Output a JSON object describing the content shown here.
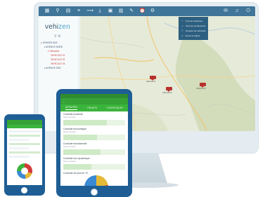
{
  "brand": {
    "logo_left": "vehi",
    "logo_right": "zen",
    "primary": "#3f7598",
    "green": "#35a235",
    "device_blue": "#1e5e95"
  },
  "toolbar": {
    "icons": [
      "grid-icon",
      "search-icon",
      "doc-icon",
      "list-icon",
      "route-icon",
      "download-icon",
      "calendar-icon",
      "report-icon",
      "wrench-icon",
      "alarm-icon",
      "gear-icon"
    ],
    "right_icons": [
      "mail-icon",
      "bell-icon",
      "power-icon"
    ]
  },
  "dropdown": {
    "items": [
      {
        "icon": "car-icon",
        "label": "Tous les véhicules"
      },
      {
        "icon": "user-icon",
        "label": "Tous les conducteurs"
      },
      {
        "icon": "group-icon",
        "label": "Groupes de véhicules"
      },
      {
        "icon": "zone-icon",
        "label": "Zones et trajets"
      }
    ]
  },
  "sidebar": {
    "tree": [
      {
        "label": "▸ VEHIZEN SAS",
        "level": 1
      },
      {
        "label": "▾ AGENCE NORD",
        "level": 2
      },
      {
        "label": "▾ Véhicules",
        "level": 3
      },
      {
        "label": "VEHICULE 01",
        "level": 4
      },
      {
        "label": "VEHICULE 02",
        "level": 4
      },
      {
        "label": "VEHICULE 03",
        "level": 4
      },
      {
        "label": "▸ AGENCE SUD",
        "level": 2
      }
    ]
  },
  "map": {
    "pins": [
      {
        "label": "Véhicule 01"
      },
      {
        "label": "Véhicule 02"
      },
      {
        "label": "Véhicule 03"
      }
    ]
  },
  "tablet": {
    "appbar": "←",
    "tabs": [
      "ACTIVITÉS",
      "TRAJETS",
      "STATISTIQUES"
    ],
    "cards": [
      {
        "title": "Conduite prudente",
        "sub": "Score mensuel",
        "fill": 0.7
      },
      {
        "title": "Conduite économique",
        "sub": "Score mensuel",
        "fill": 0.55
      },
      {
        "title": "Conduite fonctionnelle",
        "sub": "Score mensuel",
        "fill": 0.6
      },
      {
        "title": "Conduite éco-dynamique",
        "sub": "Score mensuel",
        "fill": 0.45
      },
      {
        "title": "Conduite de plus de 70",
        "sub": "",
        "fill": 0.0
      }
    ]
  }
}
